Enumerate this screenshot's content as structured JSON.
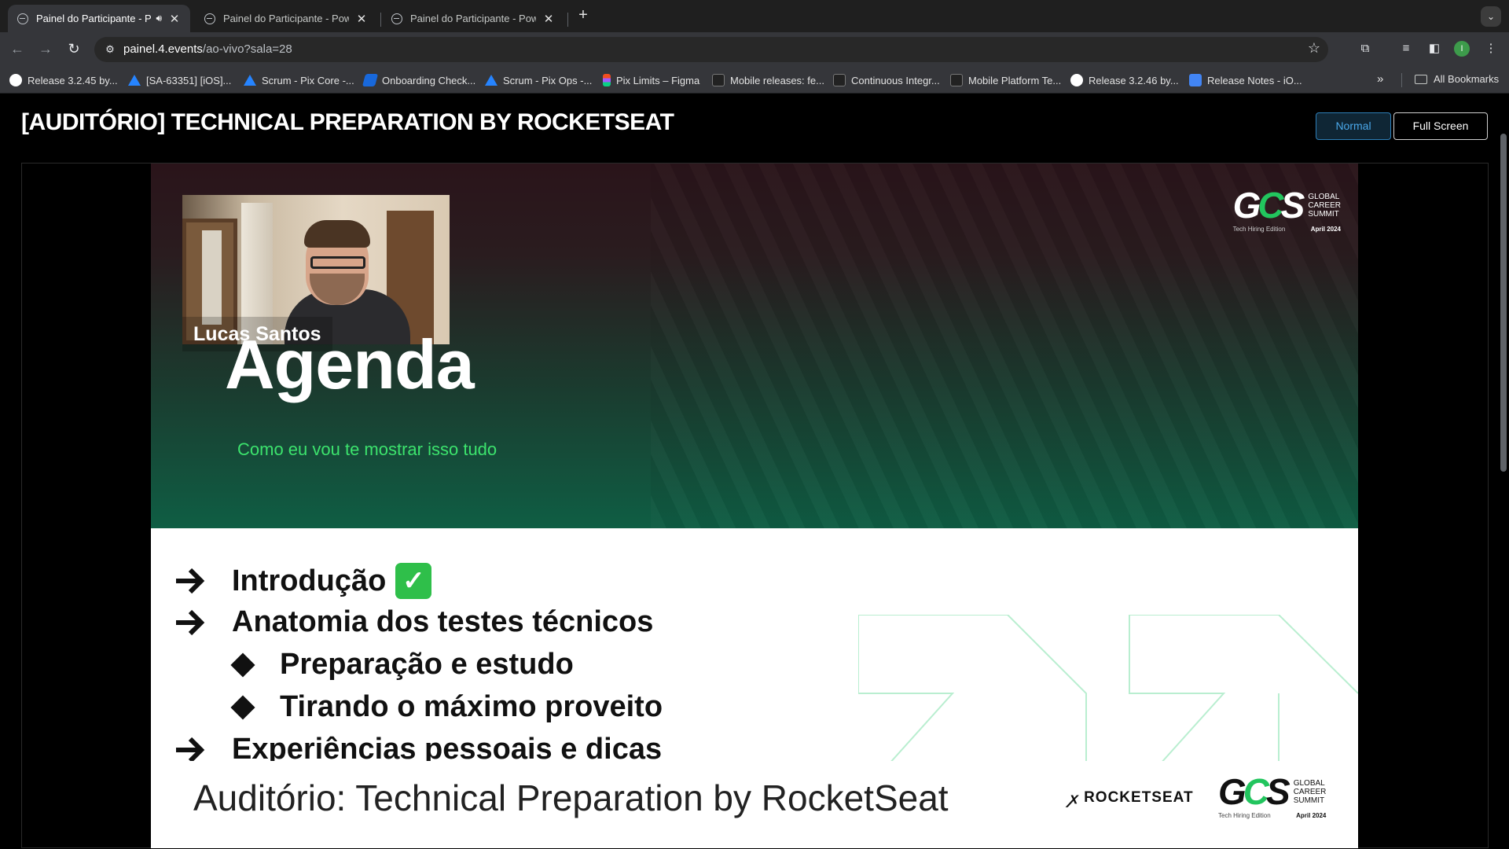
{
  "tabs": [
    {
      "title": "Painel do Participante - Pc",
      "active": true,
      "audio": true
    },
    {
      "title": "Painel do Participante - Powe",
      "active": false
    },
    {
      "title": "Painel do Participante - Powe",
      "active": false
    }
  ],
  "address": {
    "domain": "painel.4.events",
    "path": "/ao-vivo?sala=28"
  },
  "profile_initial": "I",
  "bookmarks": [
    {
      "label": "Release 3.2.45 by...",
      "icon": "github-icon"
    },
    {
      "label": "[SA-63351] [iOS]...",
      "icon": "jira-icon"
    },
    {
      "label": "Scrum - Pix Core -...",
      "icon": "jira-icon"
    },
    {
      "label": "Onboarding Check...",
      "icon": "confluence-icon"
    },
    {
      "label": "Scrum - Pix Ops -...",
      "icon": "jira-icon"
    },
    {
      "label": "Pix Limits – Figma",
      "icon": "figma-icon"
    },
    {
      "label": "Mobile releases: fe...",
      "icon": "doc-dark-icon"
    },
    {
      "label": "Continuous Integr...",
      "icon": "doc-dark-icon"
    },
    {
      "label": "Mobile Platform Te...",
      "icon": "doc-dark-icon"
    },
    {
      "label": "Release 3.2.46 by...",
      "icon": "github-icon"
    },
    {
      "label": "Release Notes - iO...",
      "icon": "google-docs-icon"
    }
  ],
  "all_bookmarks_label": "All Bookmarks",
  "page": {
    "title": "[AUDITÓRIO] TECHNICAL PREPARATION BY ROCKETSEAT",
    "normal_label": "Normal",
    "fullscreen_label": "Full Screen"
  },
  "slide": {
    "speaker_name": "Lucas Santos",
    "heading": "Agenda",
    "subheading": "Como eu vou te mostrar isso tudo",
    "items": [
      {
        "text": "Introdução",
        "level": 1,
        "done": true
      },
      {
        "text": "Anatomia dos testes técnicos",
        "level": 1
      },
      {
        "text": "Preparação e estudo",
        "level": 2
      },
      {
        "text": "Tirando o máximo proveito",
        "level": 2
      },
      {
        "text": "Experiências pessoais e dicas",
        "level": 1
      }
    ],
    "footer": "Auditório: Technical Preparation by RocketSeat",
    "rocketseat_label": "ROCKETSEAT",
    "gcs": {
      "line1": "GLOBAL",
      "line2": "CAREER",
      "line3": "SUMMIT",
      "edition": "Tech Hiring Edition",
      "date": "April 2024"
    }
  },
  "colors": {
    "accent_blue": "#4aa8ea",
    "slide_green": "#3ce36d",
    "check_green": "#2fbf4a"
  }
}
